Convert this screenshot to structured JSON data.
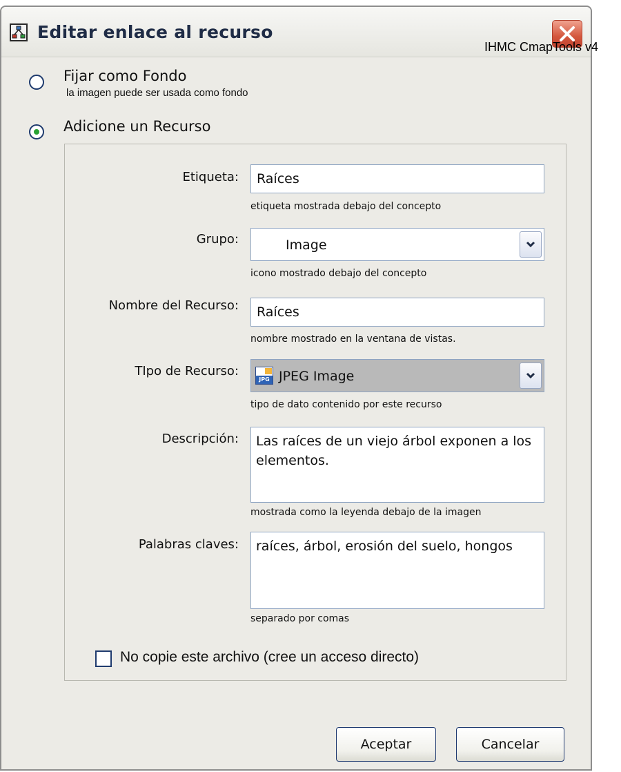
{
  "window": {
    "title": "Editar enlace al recurso",
    "app_icon": "cmap-app-icon",
    "close_icon": "close-icon",
    "overlay_label": "IHMC CmapTools v4"
  },
  "options": {
    "background": {
      "label": "Fijar como Fondo",
      "hint": "la imagen puede ser usada como fondo",
      "selected": false
    },
    "resource": {
      "label": "Adicione un Recurso",
      "selected": true
    }
  },
  "fields": {
    "etiqueta": {
      "label": "Etiqueta:",
      "value": "Raíces",
      "hint": "etiqueta mostrada debajo del concepto"
    },
    "grupo": {
      "label": "Grupo:",
      "value": "Image",
      "hint": "icono mostrado debajo del concepto"
    },
    "nombre": {
      "label": "Nombre del Recurso:",
      "value": "Raíces",
      "hint": "nombre mostrado en la ventana de vistas."
    },
    "tipo": {
      "label": "TIpo de Recurso:",
      "value": "JPEG Image",
      "icon_text": "JPG",
      "icon": "jpeg-file-icon",
      "hint": "tipo de dato contenido por este recurso"
    },
    "descripcion": {
      "label": "Descripción:",
      "value": "Las raíces de un viejo árbol exponen a los elementos.",
      "hint": "mostrada como la leyenda debajo de la imagen"
    },
    "palabras": {
      "label": "Palabras claves:",
      "value": "raíces, árbol, erosión del suelo, hongos",
      "hint": "separado por comas"
    }
  },
  "no_copy": {
    "label": "No copie este archivo  (cree un acceso directo)",
    "checked": false
  },
  "buttons": {
    "accept": "Aceptar",
    "cancel": "Cancelar"
  },
  "colors": {
    "radio_selected_dot": "#28a232",
    "close_button": "#d4573e",
    "title_text": "#1f2c46"
  }
}
